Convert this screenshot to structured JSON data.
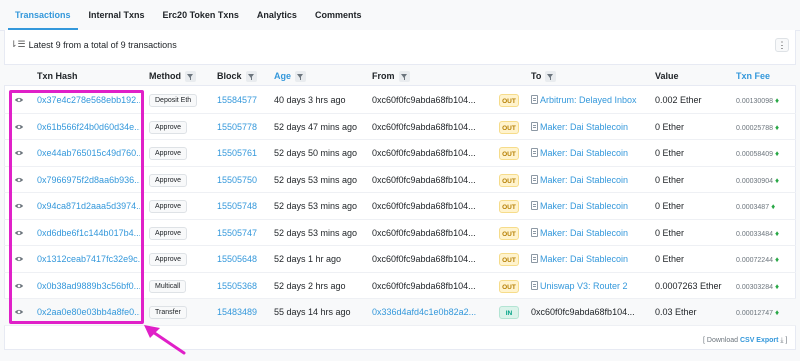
{
  "tabs": [
    "Transactions",
    "Internal Txns",
    "Erc20 Token Txns",
    "Analytics",
    "Comments"
  ],
  "summary": "Latest 9 from a total of 9 transactions",
  "more_label": "⋮",
  "headers": {
    "txn_hash": "Txn Hash",
    "method": "Method",
    "block": "Block",
    "age": "Age",
    "from": "From",
    "to": "To",
    "value": "Value",
    "txn_fee": "Txn Fee"
  },
  "rows": [
    {
      "hash": "0x37e4c278e568ebb192...",
      "method": "Deposit Eth",
      "block": "15584577",
      "age": "40 days 3 hrs ago",
      "from": "0xc60f0fc9abda68fb104...",
      "dir": "OUT",
      "to": "Arbitrum: Delayed Inbox",
      "value": "0.002 Ether",
      "fee": "0.00130098"
    },
    {
      "hash": "0x61b566f24b0d60d34e...",
      "method": "Approve",
      "block": "15505778",
      "age": "52 days 47 mins ago",
      "from": "0xc60f0fc9abda68fb104...",
      "dir": "OUT",
      "to": "Maker: Dai Stablecoin",
      "value": "0 Ether",
      "fee": "0.00025788"
    },
    {
      "hash": "0xe44ab765015c49d760...",
      "method": "Approve",
      "block": "15505761",
      "age": "52 days 50 mins ago",
      "from": "0xc60f0fc9abda68fb104...",
      "dir": "OUT",
      "to": "Maker: Dai Stablecoin",
      "value": "0 Ether",
      "fee": "0.00058409"
    },
    {
      "hash": "0x7966975f2d8aa6b936...",
      "method": "Approve",
      "block": "15505750",
      "age": "52 days 53 mins ago",
      "from": "0xc60f0fc9abda68fb104...",
      "dir": "OUT",
      "to": "Maker: Dai Stablecoin",
      "value": "0 Ether",
      "fee": "0.00030904"
    },
    {
      "hash": "0x94ca871d2aaa5d3974...",
      "method": "Approve",
      "block": "15505748",
      "age": "52 days 53 mins ago",
      "from": "0xc60f0fc9abda68fb104...",
      "dir": "OUT",
      "to": "Maker: Dai Stablecoin",
      "value": "0 Ether",
      "fee": "0.0003487"
    },
    {
      "hash": "0xd6dbe6f1c144b017b4...",
      "method": "Approve",
      "block": "15505747",
      "age": "52 days 53 mins ago",
      "from": "0xc60f0fc9abda68fb104...",
      "dir": "OUT",
      "to": "Maker: Dai Stablecoin",
      "value": "0 Ether",
      "fee": "0.00033484"
    },
    {
      "hash": "0x1312ceab7417fc32e9c...",
      "method": "Approve",
      "block": "15505648",
      "age": "52 days 1 hr ago",
      "from": "0xc60f0fc9abda68fb104...",
      "dir": "OUT",
      "to": "Maker: Dai Stablecoin",
      "value": "0 Ether",
      "fee": "0.00072244"
    },
    {
      "hash": "0x0b38ad9889b3c56bf0...",
      "method": "Multicall",
      "block": "15505368",
      "age": "52 days 2 hrs ago",
      "from": "0xc60f0fc9abda68fb104...",
      "dir": "OUT",
      "to": "Uniswap V3: Router 2",
      "value": "0.0007263 Ether",
      "fee": "0.00303284"
    },
    {
      "hash": "0x2aa0e80e03bb4a8fe0...",
      "method": "Transfer",
      "block": "15483489",
      "age": "55 days 14 hrs ago",
      "from": "0x336d4afd4c1e0b82a2...",
      "dir": "IN",
      "to": "0xc60f0fc9abda68fb104...",
      "value": "0.03 Ether",
      "fee": "0.00012747"
    }
  ],
  "download": {
    "prefix": "[ Download ",
    "link": "CSV Export",
    "suffix": " ⤓ ]"
  },
  "colors": {
    "accent": "#3498db",
    "highlight": "#e020c8",
    "out_bg": "#fff3cd",
    "in_bg": "#dbf3ea"
  }
}
